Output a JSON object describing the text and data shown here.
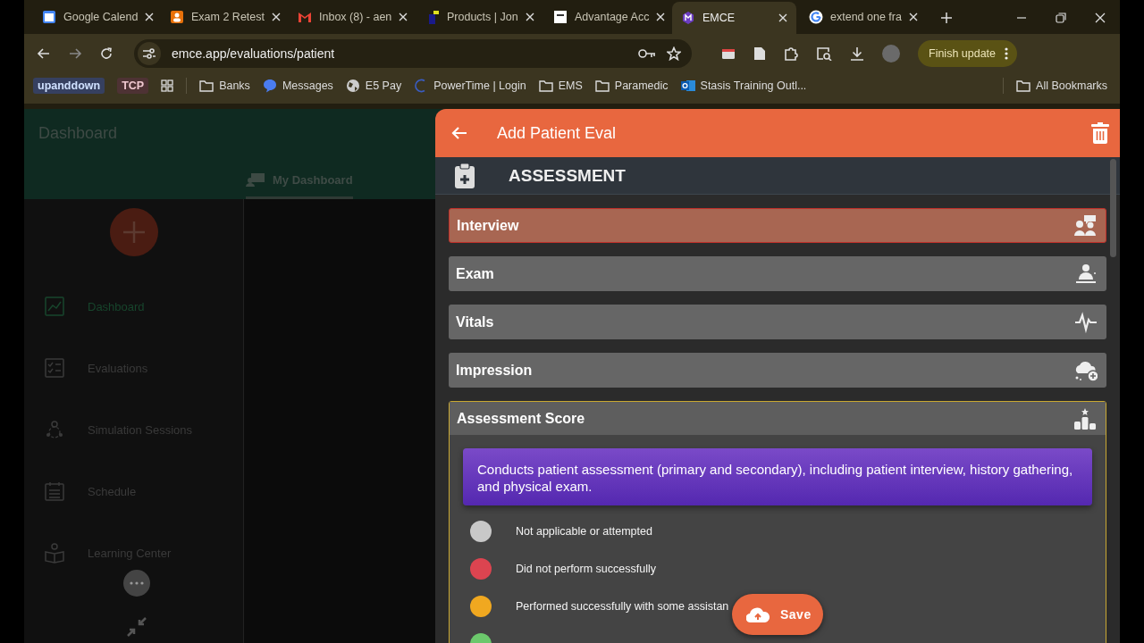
{
  "browser": {
    "tabs": [
      {
        "title": "Google Calend",
        "selected": false
      },
      {
        "title": "Exam 2 Retest",
        "selected": false
      },
      {
        "title": "Inbox (8) - aen",
        "selected": false
      },
      {
        "title": "Products | Jon",
        "selected": false
      },
      {
        "title": "Advantage Acc",
        "selected": false
      },
      {
        "title": "EMCE",
        "selected": true
      },
      {
        "title": "extend one fra",
        "selected": false
      }
    ],
    "address": "emce.app/evaluations/patient",
    "update_button": "Finish update",
    "bookmarks": [
      {
        "label": "upanddown",
        "kind": "chip"
      },
      {
        "label": "TCP",
        "kind": "chip"
      },
      {
        "label": "Banks",
        "kind": "folder"
      },
      {
        "label": "Messages",
        "kind": "link"
      },
      {
        "label": "E5 Pay",
        "kind": "link"
      },
      {
        "label": "PowerTime | Login",
        "kind": "link"
      },
      {
        "label": "EMS",
        "kind": "folder"
      },
      {
        "label": "Paramedic",
        "kind": "folder"
      },
      {
        "label": "Stasis Training Outl...",
        "kind": "link"
      }
    ],
    "all_bookmarks": "All Bookmarks"
  },
  "app": {
    "title": "Dashboard",
    "tab": "My Dashboard",
    "nav": [
      {
        "label": "Dashboard",
        "selected": true
      },
      {
        "label": "Evaluations",
        "selected": false
      },
      {
        "label": "Simulation Sessions",
        "selected": false
      },
      {
        "label": "Schedule",
        "selected": false
      },
      {
        "label": "Learning Center",
        "selected": false
      }
    ]
  },
  "panel": {
    "title": "Add Patient Eval",
    "section": "ASSESSMENT",
    "items": [
      {
        "label": "Interview",
        "selected": true,
        "expanded": false
      },
      {
        "label": "Exam",
        "selected": false,
        "expanded": false
      },
      {
        "label": "Vitals",
        "selected": false,
        "expanded": false
      },
      {
        "label": "Impression",
        "selected": false,
        "expanded": false
      },
      {
        "label": "Assessment Score",
        "selected": false,
        "expanded": true,
        "description": "Conducts patient assessment (primary and secondary), including patient interview, history gathering, and physical exam.",
        "options": [
          {
            "label": "Not applicable or attempted",
            "color": "#c8c8c8"
          },
          {
            "label": "Did not perform successfully",
            "color": "#dc4450"
          },
          {
            "label": "Performed successfully with some assistan",
            "color": "#f0a820"
          },
          {
            "color": "#6cc86c"
          }
        ]
      }
    ],
    "save_button": "Save"
  }
}
